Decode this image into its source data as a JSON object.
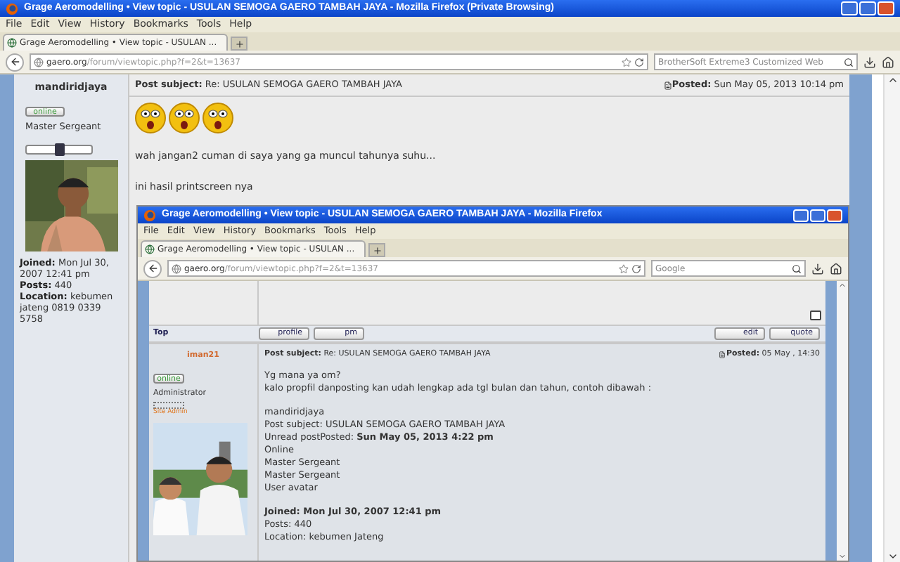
{
  "window": {
    "title": "Grage Aeromodelling • View topic - USULAN SEMOGA GAERO TAMBAH JAYA - Mozilla Firefox (Private Browsing)"
  },
  "menu": [
    "File",
    "Edit",
    "View",
    "History",
    "Bookmarks",
    "Tools",
    "Help"
  ],
  "tabs": [
    {
      "label": "Grage Aeromodelling • View topic - USULAN ...",
      "selected": true
    }
  ],
  "address": {
    "host": "gaero.org",
    "path": "/forum/viewtopic.php?f=2&t=13637"
  },
  "search": {
    "placeholder": "BrotherSoft Extreme3 Customized Web"
  },
  "post": {
    "author": "mandiridjaya",
    "status": "online",
    "rank": "Master Sergeant",
    "details": [
      {
        "label": "Joined:",
        "value": "Mon Jul 30, 2007 12:41 pm"
      },
      {
        "label": "Posts:",
        "value": "440"
      },
      {
        "label": "Location:",
        "value": "kebumen jateng 0819 0339 5758"
      }
    ],
    "subject_label": "Post subject:",
    "subject": "Re: USULAN SEMOGA GAERO TAMBAH JAYA",
    "posted_label": "Posted:",
    "posted": "Sun May 05, 2013 10:14 pm",
    "paragraphs": [
      "wah jangan2 cuman di saya yang ga muncul tahunya suhu...",
      "ini hasil printscreen nya"
    ]
  },
  "screenshot": {
    "title": "Grage Aeromodelling • View topic - USULAN SEMOGA GAERO TAMBAH JAYA - Mozilla Firefox",
    "menu": [
      "File",
      "Edit",
      "View",
      "History",
      "Bookmarks",
      "Tools",
      "Help"
    ],
    "tabs": [
      {
        "label": "Grage Aeromodelling • View topic - USULAN ...",
        "selected": true
      }
    ],
    "address": {
      "host": "gaero.org",
      "path": "/forum/viewtopic.php?f=2&t=13637"
    },
    "search": {
      "placeholder": "Google"
    },
    "top_link": "Top",
    "left_buttons": [
      "profile",
      "pm"
    ],
    "right_buttons": [
      "edit",
      "quote"
    ],
    "post": {
      "author": "iman21",
      "status": "online",
      "rank": "Administrator",
      "level": "Site Admin",
      "subject_label": "Post subject:",
      "subject": "Re: USULAN SEMOGA GAERO TAMBAH JAYA",
      "posted_label": "Posted:",
      "posted": "05 May , 14:30",
      "paragraphs": [
        "Yg mana ya om?",
        "kalo propfil danposting kan udah lengkap ada tgl bulan dan tahun, contoh dibawah :"
      ],
      "quote_lines": [
        {
          "text": "mandiridjaya"
        },
        {
          "text": "Post subject: USULAN SEMOGA GAERO TAMBAH JAYA"
        },
        {
          "text": "Unread postPosted: **Sun May 05, 2013 4:22 pm**"
        },
        {
          "text": "Online"
        },
        {
          "text": "Master Sergeant"
        },
        {
          "text": "Master Sergeant"
        },
        {
          "text": "User avatar"
        }
      ],
      "profile_lines": [
        {
          "text": "Joined: Mon Jul 30, 2007 12:41 pm",
          "bold": true
        },
        {
          "text": "Posts: 440",
          "bold": false
        },
        {
          "text": "Location: kebumen Jateng",
          "bold": false
        }
      ]
    }
  }
}
